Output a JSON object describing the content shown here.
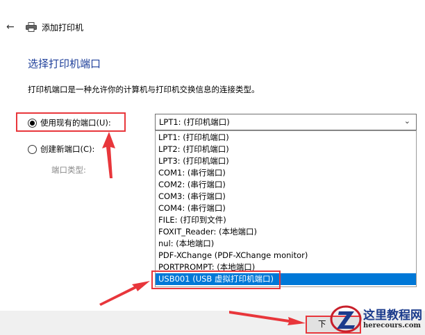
{
  "window": {
    "title": "添加打印机"
  },
  "icons": {
    "back": "back-arrow-icon",
    "printer": "printer-icon",
    "chevron": "chevron-down-icon"
  },
  "page": {
    "heading": "选择打印机端口",
    "description": "打印机端口是一种允许你的计算机与打印机交换信息的连接类型。"
  },
  "options": {
    "use_existing": "使用现有的端口(U):",
    "create_new": "创建新端口(C):",
    "port_type_label": "端口类型:"
  },
  "combo": {
    "selected": "LPT1: (打印机端口)",
    "items": [
      "LPT1: (打印机端口)",
      "LPT2: (打印机端口)",
      "LPT3: (打印机端口)",
      "COM1: (串行端口)",
      "COM2: (串行端口)",
      "COM3: (串行端口)",
      "COM4: (串行端口)",
      "FILE: (打印到文件)",
      "FOXIT_Reader: (本地端口)",
      "nul: (本地端口)",
      "PDF-XChange (PDF-XChange monitor)",
      "PORTPROMPT: (本地端口)",
      "USB001 (USB 虚拟打印机端口)"
    ],
    "highlighted_index": 12
  },
  "footer": {
    "next_label": "下"
  },
  "watermark": {
    "text": "这里教程网",
    "url": "herecours.com"
  },
  "colors": {
    "annotation_red": "#e8363b",
    "selection_blue": "#0078d7",
    "heading_blue": "#1e3f9a"
  }
}
